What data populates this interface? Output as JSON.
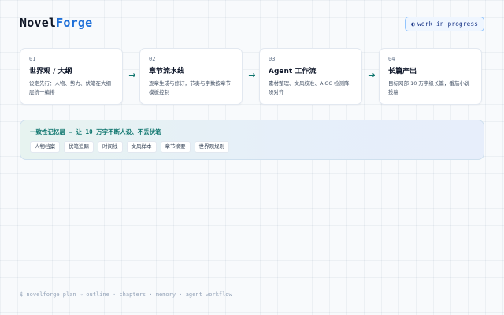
{
  "header": {
    "logo_part1": "Novel",
    "logo_part2": "Forge",
    "badge_icon": "◐",
    "badge_label": "work in progress"
  },
  "pipeline": {
    "arrow_glyph": "→",
    "steps": [
      {
        "num": "01",
        "title": "世界观 / 大纲",
        "desc": "设定先行：人物、势力、伏笔在大纲层统一编排"
      },
      {
        "num": "02",
        "title": "章节流水线",
        "desc": "逐章生成与修订，节奏与字数按章节模板控制"
      },
      {
        "num": "03",
        "title": "Agent 工作流",
        "desc": "素材整理、文风校准、AIGC 检测降噪对齐"
      },
      {
        "num": "04",
        "title": "长篇产出",
        "desc": "目标网部 10 万字级长篇，番茄小说投稿"
      }
    ]
  },
  "memory": {
    "title": "一致性记忆层 — 让 10 万字不断人设、不丢伏笔",
    "tags": [
      "人物档案",
      "伏笔追踪",
      "时间线",
      "文风样本",
      "章节摘要",
      "世界观规则"
    ]
  },
  "footer": {
    "command": "$ novelforge plan → outline · chapters · memory · agent workflow"
  },
  "colors": {
    "brand_blue": "#1d6fd8",
    "accent_teal": "#0f766e",
    "background": "#f8fafc"
  }
}
